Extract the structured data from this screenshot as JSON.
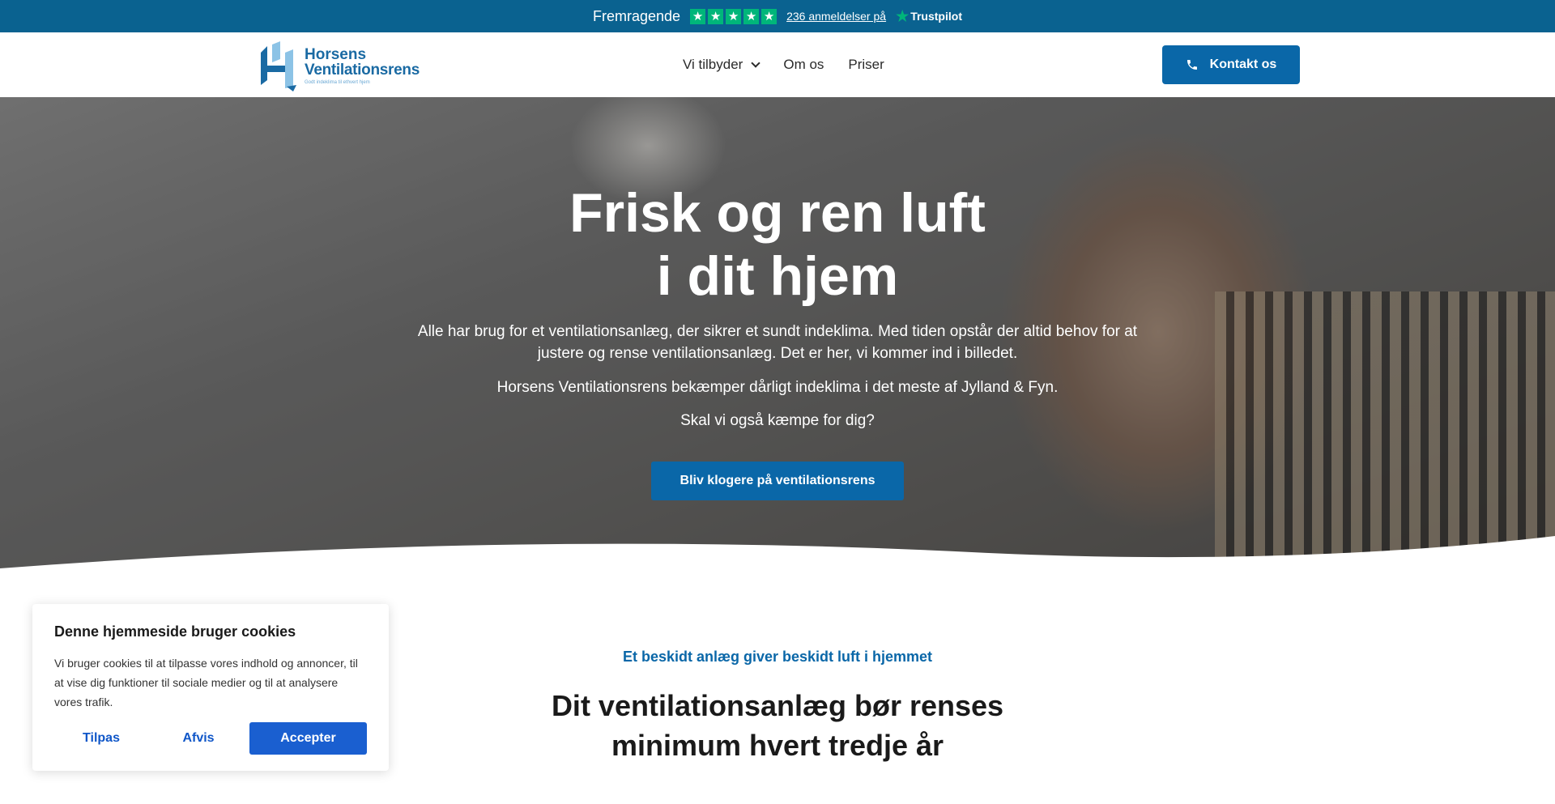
{
  "trustbar": {
    "rating_word": "Fremragende",
    "stars": 5,
    "reviews_link": "236 anmeldelser på",
    "brand": "Trustpilot",
    "star_icon": "star-icon",
    "brand_color": "#00b67a"
  },
  "header": {
    "logo": {
      "line1": "Horsens",
      "line2": "Ventilationsrens",
      "tagline": "Godt indeklima til ethvert hjem"
    },
    "nav": [
      {
        "label": "Vi tilbyder",
        "has_dropdown": true
      },
      {
        "label": "Om os"
      },
      {
        "label": "Priser"
      }
    ],
    "contact_label": "Kontakt os",
    "contact_icon": "phone-icon"
  },
  "hero": {
    "title_line1": "Frisk og ren luft",
    "title_line2": "i dit hjem",
    "paragraph1": "Alle har brug for et ventilationsanlæg, der sikrer et sundt indeklima. Med tiden opstår der altid behov for at justere og rense ventilationsanlæg. Det er her, vi kommer ind i billedet.",
    "paragraph2": "Horsens Ventilationsrens bekæmper dårligt indeklima i det meste af Jylland & Fyn.",
    "paragraph3": "Skal vi også kæmpe for dig?",
    "cta_label": "Bliv klogere på ventilationsrens"
  },
  "section": {
    "kicker": "Et beskidt anlæg giver beskidt luft i hjemmet",
    "title_line1": "Dit ventilationsanlæg bør renses",
    "title_line2": "minimum hvert tredje år"
  },
  "cookie": {
    "title": "Denne hjemmeside bruger cookies",
    "text": "Vi bruger cookies til at tilpasse vores indhold og annoncer, til at vise dig funktioner til sociale medier og til at analysere vores trafik.",
    "customize_label": "Tilpas",
    "reject_label": "Afvis",
    "accept_label": "Accepter"
  },
  "colors": {
    "primary_blue": "#0a67a8",
    "trustbar_bg": "#0a6290",
    "cookie_accent": "#1a5fd0"
  }
}
